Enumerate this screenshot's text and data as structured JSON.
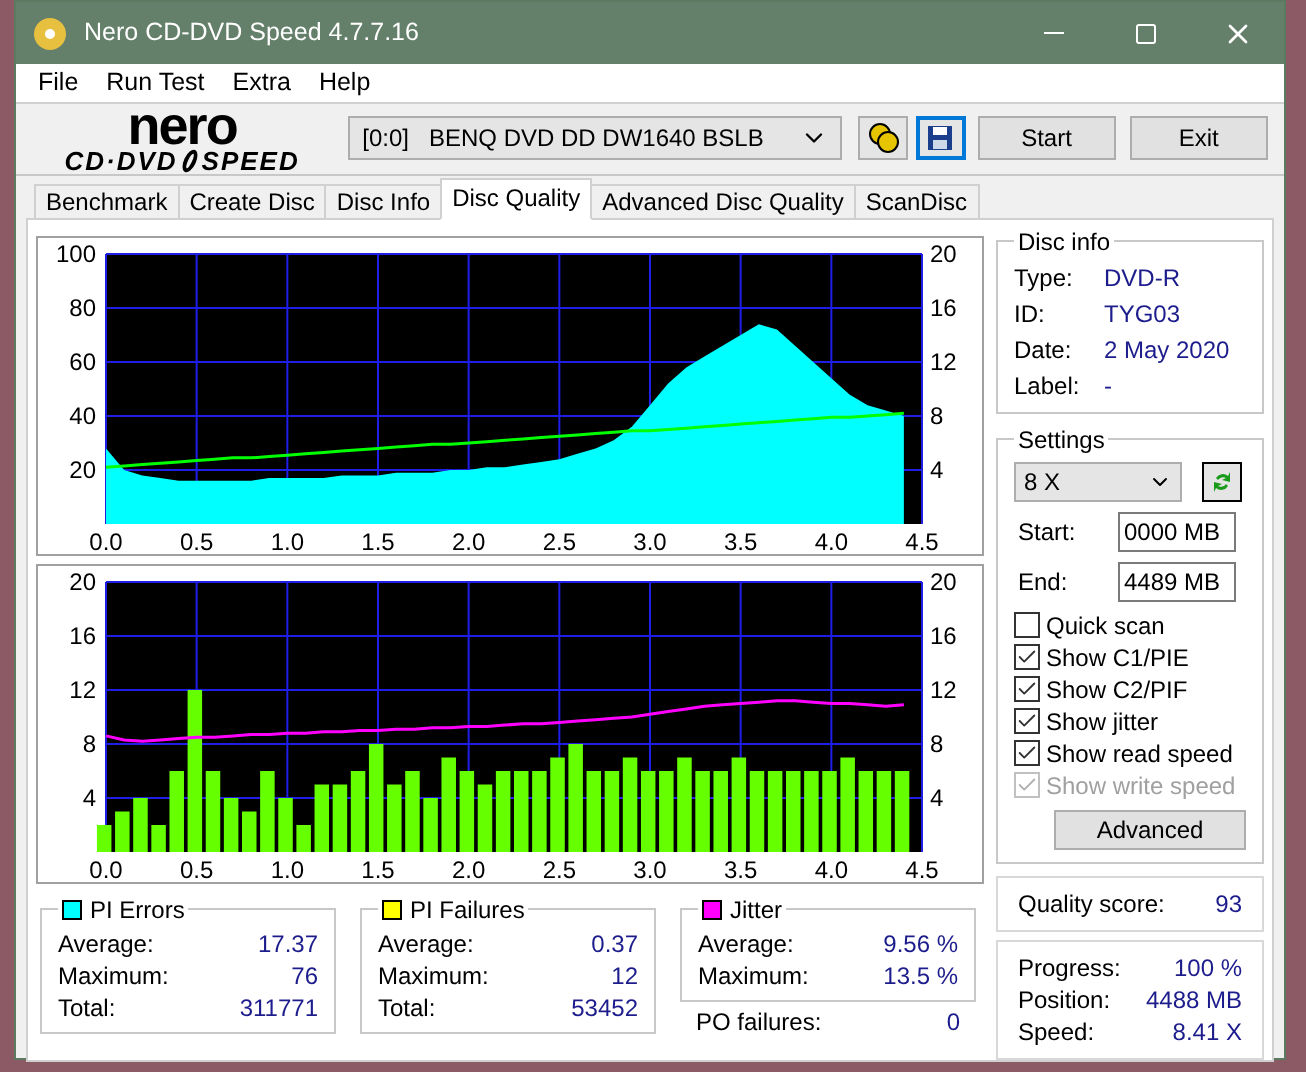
{
  "window": {
    "title": "Nero CD-DVD Speed 4.7.7.16"
  },
  "menu": [
    "File",
    "Run Test",
    "Extra",
    "Help"
  ],
  "logo": {
    "top": "nero",
    "left": "CD·DVD",
    "right": "SPEED"
  },
  "toolbar": {
    "drive": "[0:0]   BENQ DVD DD DW1640 BSLB",
    "start": "Start",
    "exit": "Exit"
  },
  "tabs": [
    {
      "label": "Benchmark",
      "selected": false
    },
    {
      "label": "Create Disc",
      "selected": false
    },
    {
      "label": "Disc Info",
      "selected": false
    },
    {
      "label": "Disc Quality",
      "selected": true
    },
    {
      "label": "Advanced Disc Quality",
      "selected": false
    },
    {
      "label": "ScanDisc",
      "selected": false
    }
  ],
  "charts": [
    {
      "chart_data": {
        "type": "area",
        "grid": true,
        "xlim": [
          0,
          4.5
        ],
        "ylim": [
          0,
          100
        ],
        "y2lim": [
          0,
          20
        ],
        "y2ticks": [
          4,
          8,
          12,
          16,
          20
        ],
        "xticks": [
          {
            "value": 0,
            "label": "0.0"
          },
          {
            "value": 0.5,
            "label": "0.5"
          },
          {
            "value": 1,
            "label": "1.0"
          },
          {
            "value": 1.5,
            "label": "1.5"
          },
          {
            "value": 2,
            "label": "2.0"
          },
          {
            "value": 2.5,
            "label": "2.5"
          },
          {
            "value": 3,
            "label": "3.0"
          },
          {
            "value": 3.5,
            "label": "3.5"
          },
          {
            "value": 4,
            "label": "4.0"
          },
          {
            "value": 4.5,
            "label": "4.5"
          }
        ],
        "yticks": [
          20,
          40,
          60,
          80,
          100
        ],
        "x": [
          0,
          0.1,
          0.2,
          0.3,
          0.4,
          0.5,
          0.6,
          0.7,
          0.8,
          0.9,
          1,
          1.1,
          1.2,
          1.3,
          1.4,
          1.5,
          1.6,
          1.7,
          1.8,
          1.9,
          2,
          2.1,
          2.2,
          2.3,
          2.4,
          2.5,
          2.6,
          2.7,
          2.8,
          2.9,
          3,
          3.1,
          3.2,
          3.3,
          3.4,
          3.5,
          3.6,
          3.7,
          3.8,
          3.9,
          4,
          4.1,
          4.2,
          4.3,
          4.4
        ],
        "series": [
          {
            "color": "#00ffff",
            "values": [
              28,
              20,
              18,
              17,
              16,
              16,
              16,
              16,
              16,
              17,
              17,
              17,
              17,
              18,
              18,
              18,
              19,
              19,
              19,
              20,
              20,
              21,
              21,
              22,
              23,
              24,
              26,
              28,
              31,
              36,
              44,
              52,
              58,
              62,
              66,
              70,
              74,
              72,
              66,
              60,
              54,
              48,
              44,
              42,
              40
            ]
          },
          {
            "type": "line",
            "axis": "y2",
            "color": "#00ff00",
            "values": [
              4.2,
              4.3,
              4.4,
              4.5,
              4.6,
              4.7,
              4.8,
              4.9,
              4.9,
              5.0,
              5.1,
              5.2,
              5.3,
              5.4,
              5.5,
              5.6,
              5.7,
              5.8,
              5.9,
              5.9,
              6.0,
              6.1,
              6.2,
              6.3,
              6.4,
              6.5,
              6.6,
              6.7,
              6.8,
              6.9,
              6.9,
              7.0,
              7.1,
              7.2,
              7.3,
              7.4,
              7.5,
              7.6,
              7.7,
              7.8,
              7.9,
              7.9,
              8.0,
              8.1,
              8.2
            ]
          }
        ]
      }
    },
    {
      "chart_data": {
        "type": "bar",
        "grid": true,
        "xlim": [
          0,
          4.5
        ],
        "ylim": [
          0,
          20
        ],
        "y2lim": [
          0,
          20
        ],
        "y2ticks": [
          4,
          8,
          12,
          16,
          20
        ],
        "xticks": [
          {
            "value": 0,
            "label": "0.0"
          },
          {
            "value": 0.5,
            "label": "0.5"
          },
          {
            "value": 1,
            "label": "1.0"
          },
          {
            "value": 1.5,
            "label": "1.5"
          },
          {
            "value": 2,
            "label": "2.0"
          },
          {
            "value": 2.5,
            "label": "2.5"
          },
          {
            "value": 3,
            "label": "3.0"
          },
          {
            "value": 3.5,
            "label": "3.5"
          },
          {
            "value": 4,
            "label": "4.0"
          },
          {
            "value": 4.5,
            "label": "4.5"
          }
        ],
        "yticks": [
          4,
          8,
          12,
          16,
          20
        ],
        "x": [
          0,
          0.1,
          0.2,
          0.3,
          0.4,
          0.5,
          0.6,
          0.7,
          0.8,
          0.9,
          1,
          1.1,
          1.2,
          1.3,
          1.4,
          1.5,
          1.6,
          1.7,
          1.8,
          1.9,
          2,
          2.1,
          2.2,
          2.3,
          2.4,
          2.5,
          2.6,
          2.7,
          2.8,
          2.9,
          3,
          3.1,
          3.2,
          3.3,
          3.4,
          3.5,
          3.6,
          3.7,
          3.8,
          3.9,
          4,
          4.1,
          4.2,
          4.3,
          4.4
        ],
        "series": [
          {
            "color": "#66ff00",
            "values": [
              2,
              3,
              4,
              2,
              6,
              12,
              6,
              4,
              3,
              6,
              4,
              2,
              5,
              5,
              6,
              8,
              5,
              6,
              4,
              7,
              6,
              5,
              6,
              6,
              6,
              7,
              8,
              6,
              6,
              7,
              6,
              6,
              7,
              6,
              6,
              7,
              6,
              6,
              6,
              6,
              6,
              7,
              6,
              6,
              6
            ]
          },
          {
            "type": "line",
            "axis": "y2",
            "color": "#ff00ff",
            "values": [
              8.6,
              8.3,
              8.2,
              8.3,
              8.4,
              8.5,
              8.5,
              8.6,
              8.7,
              8.7,
              8.8,
              8.8,
              8.9,
              8.9,
              9.0,
              9.0,
              9.1,
              9.1,
              9.2,
              9.2,
              9.3,
              9.3,
              9.4,
              9.5,
              9.5,
              9.6,
              9.7,
              9.8,
              9.9,
              10.0,
              10.2,
              10.4,
              10.6,
              10.8,
              10.9,
              11.0,
              11.1,
              11.2,
              11.2,
              11.1,
              11.0,
              11.0,
              10.9,
              10.8,
              10.9
            ]
          }
        ]
      }
    }
  ],
  "stats": [
    {
      "title": "PI Errors",
      "color": "#00ffff",
      "rows": [
        {
          "label": "Average:",
          "value": "17.37"
        },
        {
          "label": "Maximum:",
          "value": "76"
        },
        {
          "label": "Total:",
          "value": "311771"
        }
      ]
    },
    {
      "title": "PI Failures",
      "color": "#ffff00",
      "rows": [
        {
          "label": "Average:",
          "value": "0.37"
        },
        {
          "label": "Maximum:",
          "value": "12"
        },
        {
          "label": "Total:",
          "value": "53452"
        }
      ]
    },
    {
      "title": "Jitter",
      "color": "#ff00ff",
      "rows": [
        {
          "label": "Average:",
          "value": "9.56 %"
        },
        {
          "label": "Maximum:",
          "value": "13.5 %"
        }
      ]
    }
  ],
  "po_failures": {
    "label": "PO failures:",
    "value": "0"
  },
  "disc_info": {
    "title": "Disc info",
    "rows": [
      {
        "label": "Type:",
        "value": "DVD-R"
      },
      {
        "label": "ID:",
        "value": "TYG03"
      },
      {
        "label": "Date:",
        "value": "2 May 2020"
      },
      {
        "label": "Label:",
        "value": "-"
      }
    ]
  },
  "settings": {
    "title": "Settings",
    "speed": "8 X",
    "start_label": "Start:",
    "start": "0000 MB",
    "end_label": "End:",
    "end": "4489 MB",
    "options": [
      {
        "label": "Quick scan",
        "checked": false,
        "disabled": false
      },
      {
        "label": "Show C1/PIE",
        "checked": true,
        "disabled": false
      },
      {
        "label": "Show C2/PIF",
        "checked": true,
        "disabled": false
      },
      {
        "label": "Show jitter",
        "checked": true,
        "disabled": false
      },
      {
        "label": "Show read speed",
        "checked": true,
        "disabled": false
      },
      {
        "label": "Show write speed",
        "checked": true,
        "disabled": true
      }
    ],
    "advanced": "Advanced"
  },
  "quality": {
    "label": "Quality score:",
    "value": "93"
  },
  "progress": [
    {
      "label": "Progress:",
      "value": "100 %"
    },
    {
      "label": "Position:",
      "value": "4488 MB"
    },
    {
      "label": "Speed:",
      "value": "8.41 X"
    }
  ]
}
